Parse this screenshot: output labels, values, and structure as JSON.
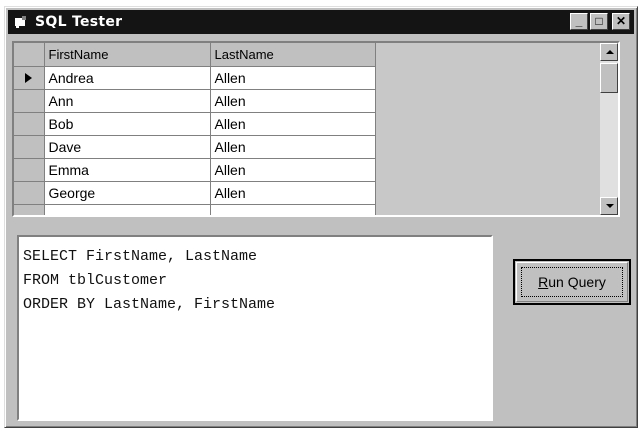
{
  "window": {
    "title": "SQL Tester"
  },
  "caption_buttons": {
    "minimize": "_",
    "maximize": "□",
    "close": "✕"
  },
  "grid": {
    "columns": [
      "FirstName",
      "LastName"
    ],
    "rows": [
      [
        "Andrea",
        "Allen"
      ],
      [
        "Ann",
        "Allen"
      ],
      [
        "Bob",
        "Allen"
      ],
      [
        "Dave",
        "Allen"
      ],
      [
        "Emma",
        "Allen"
      ],
      [
        "George",
        "Allen"
      ]
    ],
    "current_row": 0
  },
  "query": {
    "lines": [
      "SELECT FirstName, LastName",
      "FROM tblCustomer",
      "ORDER BY LastName, FirstName"
    ]
  },
  "run_button": {
    "label": "Run Query",
    "mnemonic": "R"
  }
}
